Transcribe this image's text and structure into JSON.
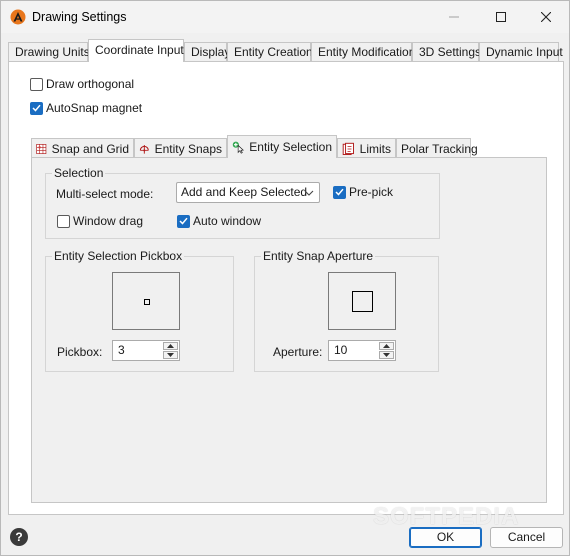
{
  "window": {
    "title": "Drawing Settings",
    "icon": "app-logo-icon",
    "controls": [
      "minimize-icon",
      "maximize-icon",
      "close-icon"
    ]
  },
  "outer_tabs": [
    {
      "label": "Drawing Units",
      "active": false
    },
    {
      "label": "Coordinate Input",
      "active": true
    },
    {
      "label": "Display",
      "active": false
    },
    {
      "label": "Entity Creation",
      "active": false
    },
    {
      "label": "Entity Modification",
      "active": false
    },
    {
      "label": "3D Settings",
      "active": false
    },
    {
      "label": "Dynamic Input",
      "active": false
    }
  ],
  "options": {
    "draw_orthogonal": {
      "label": "Draw orthogonal",
      "checked": false
    },
    "autosnap_magnet": {
      "label": "AutoSnap magnet",
      "checked": true
    }
  },
  "inner_tabs": [
    {
      "label": "Snap and Grid",
      "icon": "grid-icon",
      "active": false
    },
    {
      "label": "Entity Snaps",
      "icon": "snap-target-icon",
      "active": false
    },
    {
      "label": "Entity Selection",
      "icon": "select-cursor-icon",
      "active": true
    },
    {
      "label": "Limits",
      "icon": "limits-icon",
      "active": false
    },
    {
      "label": "Polar Tracking",
      "icon": "",
      "active": false
    }
  ],
  "selection": {
    "title": "Selection",
    "multi_select_label": "Multi-select mode:",
    "multi_select_value": "Add and Keep Selected",
    "pre_pick": {
      "label": "Pre-pick",
      "checked": true
    },
    "window_drag": {
      "label": "Window drag",
      "checked": false
    },
    "auto_window": {
      "label": "Auto window",
      "checked": true
    }
  },
  "pickbox": {
    "title": "Entity Selection Pickbox",
    "label": "Pickbox:",
    "value": "3"
  },
  "aperture": {
    "title": "Entity Snap Aperture",
    "label": "Aperture:",
    "value": "10"
  },
  "footer": {
    "help": "?",
    "ok_label": "OK",
    "cancel_label": "Cancel"
  },
  "watermark": "SOFTPEDIA",
  "colors": {
    "accent": "#1a6dc2",
    "panel": "#f0f0f0"
  }
}
